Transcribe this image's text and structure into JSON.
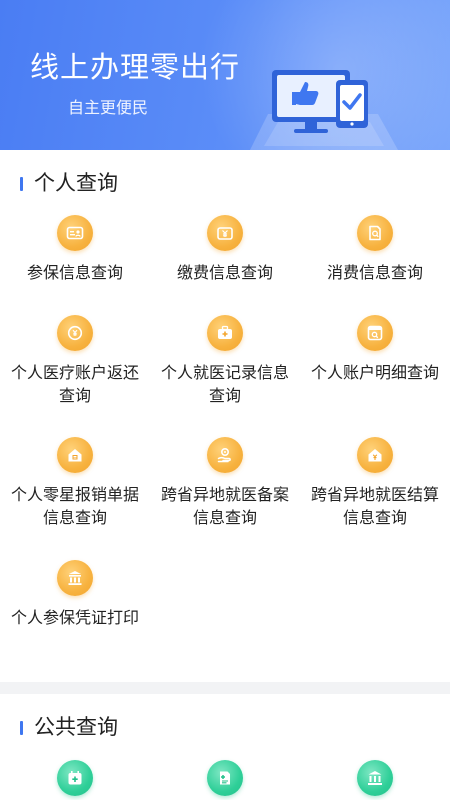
{
  "banner": {
    "title": "线上办理零出行",
    "subtitle": "自主更便民"
  },
  "personal": {
    "title": "个人查询",
    "items": [
      {
        "label": "参保信息查询",
        "icon": "id-card-icon"
      },
      {
        "label": "缴费信息查询",
        "icon": "yuan-wallet-icon"
      },
      {
        "label": "消费信息查询",
        "icon": "receipt-search-icon"
      },
      {
        "label": "个人医疗账户返还查询",
        "icon": "refund-yuan-icon"
      },
      {
        "label": "个人就医记录信息查询",
        "icon": "medical-kit-icon"
      },
      {
        "label": "个人账户明细查询",
        "icon": "account-detail-icon"
      },
      {
        "label": "个人零星报销单据信息查询",
        "icon": "house-document-icon"
      },
      {
        "label": "跨省异地就医备案信息查询",
        "icon": "location-hand-icon"
      },
      {
        "label": "跨省异地就医结算信息查询",
        "icon": "house-settlement-icon"
      },
      {
        "label": "个人参保凭证打印",
        "icon": "print-certificate-icon"
      }
    ]
  },
  "public": {
    "title": "公共查询",
    "items": [
      {
        "icon": "calendar-plus-icon"
      },
      {
        "icon": "medical-record-icon"
      },
      {
        "icon": "institution-icon"
      }
    ]
  },
  "colors": {
    "accent": "#3f77f0",
    "orange_icon": "#f7b23f",
    "green_icon": "#2fcf98"
  }
}
